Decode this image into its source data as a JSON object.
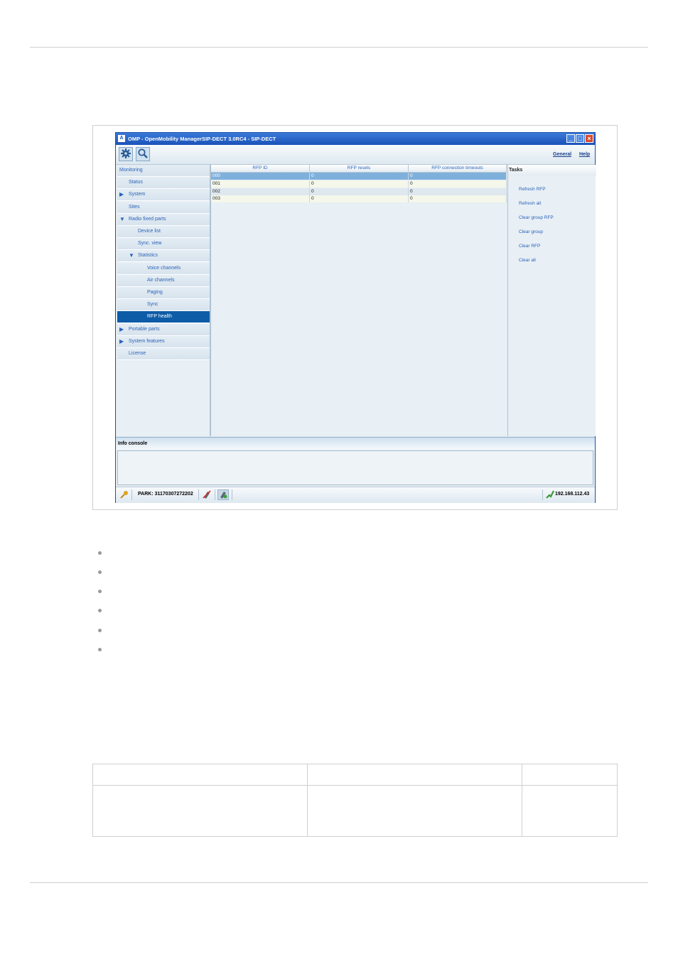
{
  "window": {
    "title": "OMP - OpenMobility ManagerSIP-DECT 3.0RC4 - SIP-DECT",
    "app_icon": "A",
    "controls": {
      "minimize": "_",
      "maximize": "□",
      "close": "×"
    }
  },
  "toolbar": {
    "icons": [
      "gear-icon",
      "search-icon"
    ],
    "menus": [
      "General",
      "Help"
    ]
  },
  "nav": {
    "items": [
      {
        "label": "Monitoring",
        "level": 0,
        "arrow": "",
        "selected": false
      },
      {
        "label": "Status",
        "level": 1,
        "arrow": "",
        "selected": false
      },
      {
        "label": "System",
        "level": 1,
        "arrow": "▶",
        "selected": false
      },
      {
        "label": "Sites",
        "level": 1,
        "arrow": "",
        "selected": false
      },
      {
        "label": "Radio fixed parts",
        "level": 1,
        "arrow": "▼",
        "selected": false
      },
      {
        "label": "Device list",
        "level": 2,
        "arrow": "",
        "selected": false
      },
      {
        "label": "Sync. view",
        "level": 2,
        "arrow": "",
        "selected": false
      },
      {
        "label": "Statistics",
        "level": 2,
        "arrow": "▼",
        "selected": false
      },
      {
        "label": "Voice channels",
        "level": 3,
        "arrow": "",
        "selected": false
      },
      {
        "label": "Air channels",
        "level": 3,
        "arrow": "",
        "selected": false
      },
      {
        "label": "Paging",
        "level": 3,
        "arrow": "",
        "selected": false
      },
      {
        "label": "Sync",
        "level": 3,
        "arrow": "",
        "selected": false
      },
      {
        "label": "RFP health",
        "level": 3,
        "arrow": "",
        "selected": true
      },
      {
        "label": "Portable parts",
        "level": 1,
        "arrow": "▶",
        "selected": false
      },
      {
        "label": "System features",
        "level": 1,
        "arrow": "▶",
        "selected": false
      },
      {
        "label": "License",
        "level": 1,
        "arrow": "",
        "selected": false
      }
    ]
  },
  "table": {
    "columns": [
      "RFP ID",
      "RFP resets",
      "RFP connection timeouts"
    ],
    "rows": [
      {
        "cells": [
          "000",
          "0",
          "0"
        ],
        "selected": true
      },
      {
        "cells": [
          "001",
          "0",
          "0"
        ],
        "selected": false
      },
      {
        "cells": [
          "002",
          "0",
          "0"
        ],
        "selected": false
      },
      {
        "cells": [
          "003",
          "0",
          "0"
        ],
        "selected": false
      }
    ]
  },
  "tasks": {
    "title": "Tasks",
    "items": [
      "Refresh RFP",
      "Refresh all",
      "Clear group RFP",
      "Clear group",
      "Clear RFP",
      "Clear all"
    ]
  },
  "console": {
    "title": "Info console"
  },
  "statusbar": {
    "park": "PARK: 31170307272202",
    "ip": "192.168.112.43"
  },
  "colors": {
    "titlebar": "#1a52b8",
    "selected_nav": "#0c5ca8",
    "selected_row": "#7fb0dc",
    "link": "#2b63b8"
  }
}
